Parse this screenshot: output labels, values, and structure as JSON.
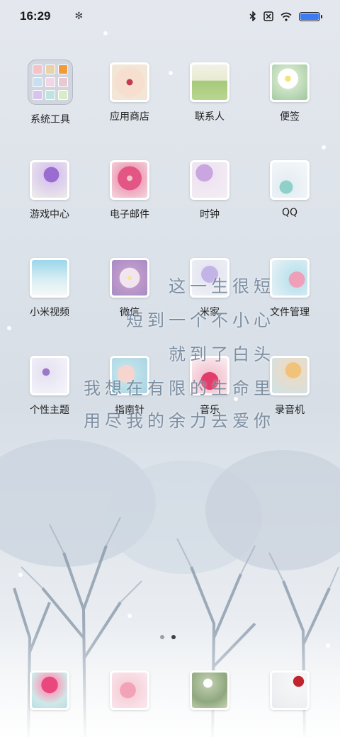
{
  "status_bar": {
    "time": "16:29",
    "icons": [
      "gear-icon",
      "bluetooth-icon",
      "sim-off-icon",
      "wifi-icon",
      "battery-icon"
    ],
    "battery_level": 1.0,
    "battery_color": "#3d7bf5"
  },
  "apps": [
    {
      "label": "系统工具",
      "type": "folder"
    },
    {
      "label": "应用商店"
    },
    {
      "label": "联系人"
    },
    {
      "label": "便签"
    },
    {
      "label": "游戏中心"
    },
    {
      "label": "电子邮件"
    },
    {
      "label": "时钟"
    },
    {
      "label": "QQ"
    },
    {
      "label": "小米视频"
    },
    {
      "label": "微信"
    },
    {
      "label": "米家"
    },
    {
      "label": "文件管理"
    },
    {
      "label": "个性主题"
    },
    {
      "label": "指南针"
    },
    {
      "label": "音乐"
    },
    {
      "label": "录音机"
    }
  ],
  "poem": {
    "line1": "这一生很短",
    "line2": "短到一个不小心",
    "line3": "就到了白头",
    "line4": "我想在有限的生命里",
    "line5": "用尽我的余力去爱你"
  },
  "page_indicator": {
    "pages": 2,
    "current": 2
  },
  "dock": [
    {
      "icon": "tulip-photo-icon"
    },
    {
      "icon": "pink-tulip-photo-icon"
    },
    {
      "icon": "dandelion-photo-icon"
    },
    {
      "icon": "heart-balloon-photo-icon"
    }
  ]
}
